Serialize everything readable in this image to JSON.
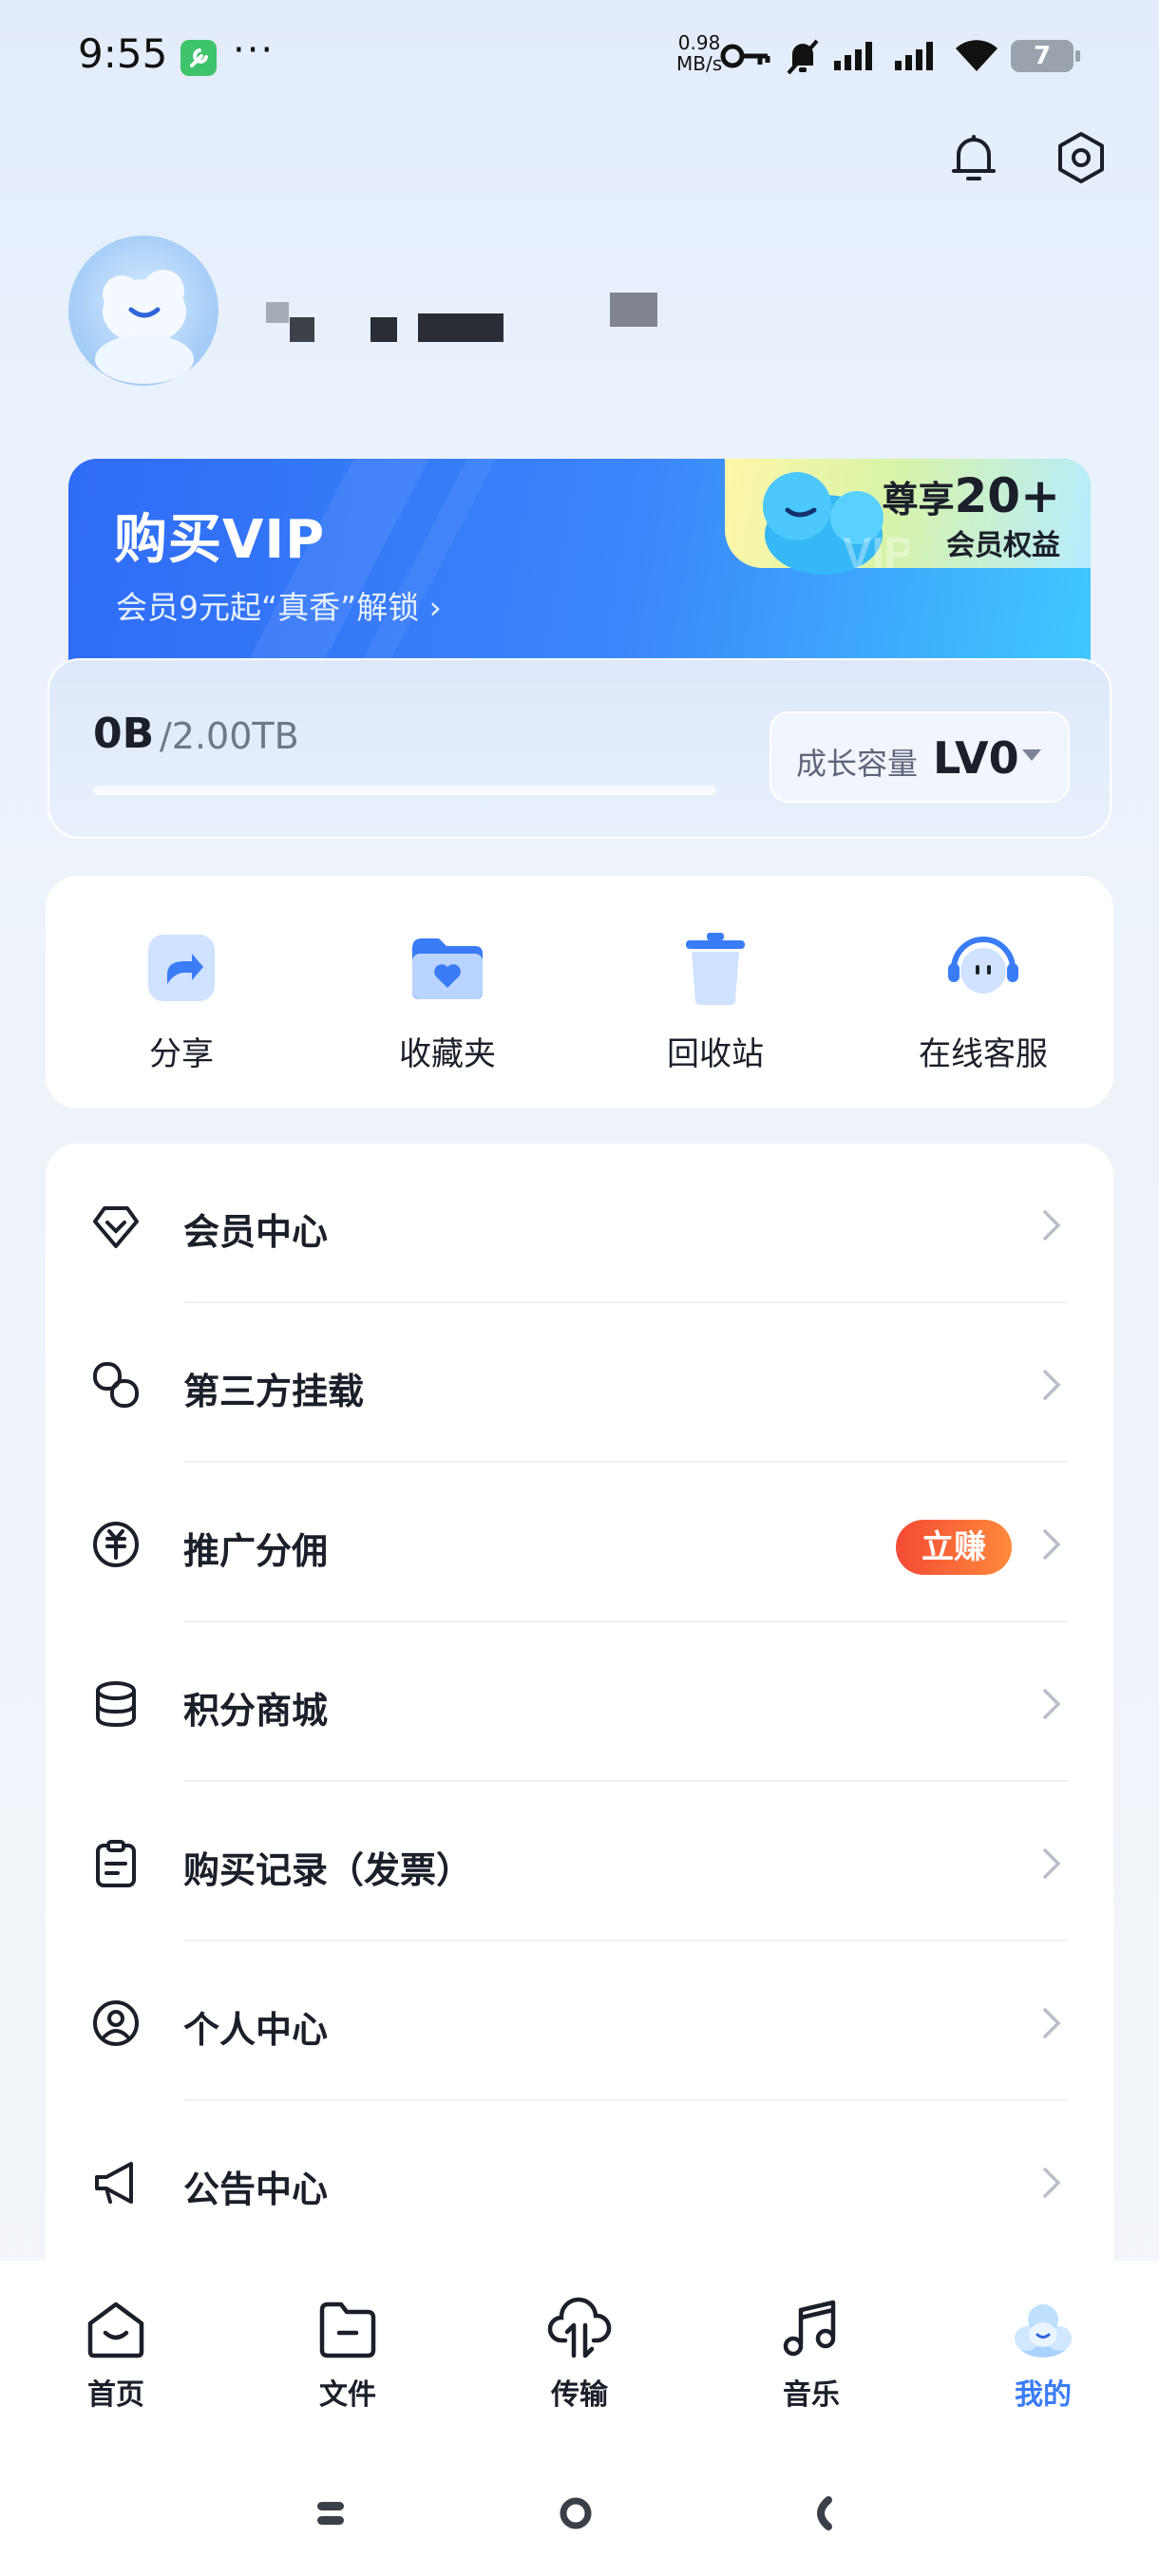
{
  "status_bar": {
    "time": "9:55",
    "dots": "···",
    "speed_value": "0.98",
    "speed_unit": "MB/s",
    "battery": "7"
  },
  "header": {
    "bell_icon": "bell-icon",
    "settings_icon": "settings-icon"
  },
  "vip_banner": {
    "title": "购买VIP",
    "subtitle": "会员9元起“真香”解锁 ›",
    "perk_prefix": "尊享",
    "perk_number": "20+",
    "perk_label": "会员权益",
    "watermark": "VIP"
  },
  "storage": {
    "used": "0B",
    "total": "/2.00TB",
    "used_fraction": 0,
    "level_label": "成长容量",
    "level_value": "LV0"
  },
  "quick_actions": [
    {
      "label": "分享",
      "icon": "share-icon"
    },
    {
      "label": "收藏夹",
      "icon": "favorites-folder-icon"
    },
    {
      "label": "回收站",
      "icon": "recycle-bin-icon"
    },
    {
      "label": "在线客服",
      "icon": "customer-service-icon"
    }
  ],
  "menu": [
    {
      "label": "会员中心",
      "icon": "diamond-icon"
    },
    {
      "label": "第三方挂载",
      "icon": "link-icon"
    },
    {
      "label": "推广分佣",
      "icon": "coin-icon",
      "badge": "立赚"
    },
    {
      "label": "积分商城",
      "icon": "database-icon"
    },
    {
      "label": "购买记录（发票）",
      "icon": "clipboard-icon"
    },
    {
      "label": "个人中心",
      "icon": "user-circle-icon"
    },
    {
      "label": "公告中心",
      "icon": "megaphone-icon"
    }
  ],
  "bottom_nav": [
    {
      "label": "首页",
      "icon": "home-icon"
    },
    {
      "label": "文件",
      "icon": "folder-icon"
    },
    {
      "label": "传输",
      "icon": "cloud-transfer-icon"
    },
    {
      "label": "音乐",
      "icon": "music-icon"
    },
    {
      "label": "我的",
      "icon": "profile-mascot-icon",
      "active": true
    }
  ],
  "colors": {
    "accent": "#3a7cf6",
    "vip_gradient_start": "#2f6bf5",
    "vip_gradient_end": "#40c8ff",
    "badge": "#f44a35",
    "text": "#1b1f2a"
  }
}
